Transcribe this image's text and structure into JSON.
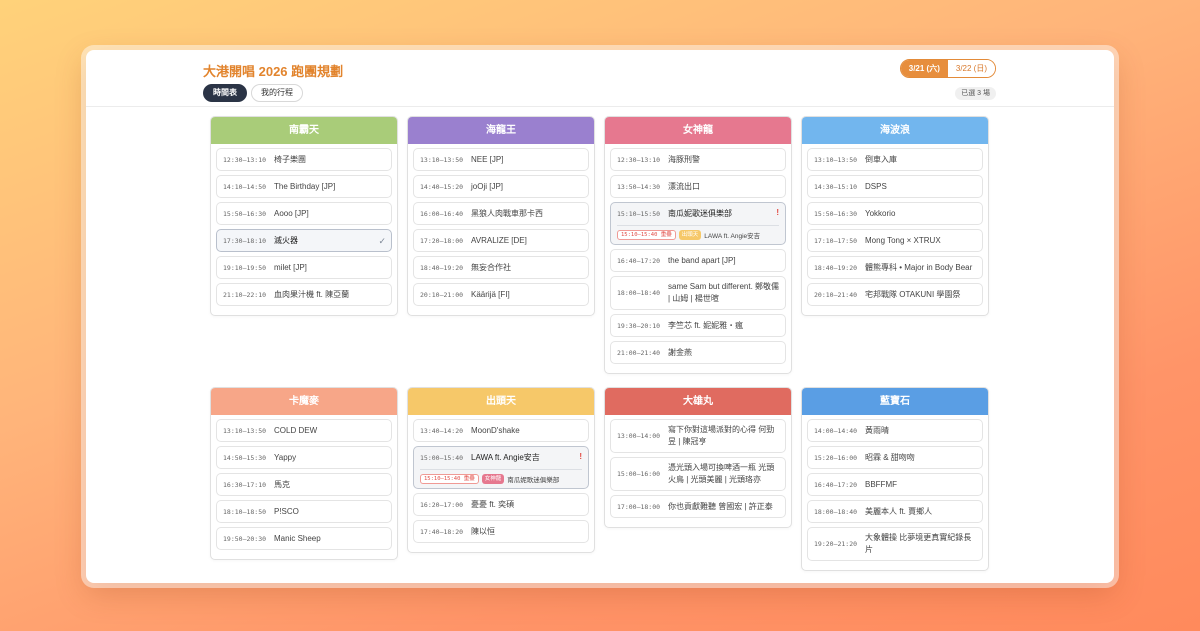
{
  "app": {
    "title": "大港開唱 2026 跑團規劃",
    "view_tabs": [
      "時間表",
      "我的行程"
    ],
    "day_tabs": [
      "3/21 (六)",
      "3/22 (日)"
    ],
    "selected_count": "已選 3 場"
  },
  "colors": {
    "accent": "#e2842d",
    "nav_active": "#2b3446",
    "conflict_red": "#e14b45"
  },
  "stages": [
    {
      "name": "南霸天",
      "color": "#a9cc79",
      "slots": [
        {
          "time": "12:30–13:10",
          "artist": "椅子樂團"
        },
        {
          "time": "14:10–14:50",
          "artist": "The Birthday [JP]"
        },
        {
          "time": "15:50–16:30",
          "artist": "Aooo [JP]"
        },
        {
          "time": "17:30–18:10",
          "artist": "滅火器",
          "selected": true
        },
        {
          "time": "19:10–19:50",
          "artist": "milet [JP]"
        },
        {
          "time": "21:10–22:10",
          "artist": "血肉果汁機 ft. 陳亞蘭"
        }
      ]
    },
    {
      "name": "海龍王",
      "color": "#9a80cf",
      "slots": [
        {
          "time": "13:10–13:50",
          "artist": "NEE [JP]"
        },
        {
          "time": "14:40–15:20",
          "artist": "joOji [JP]"
        },
        {
          "time": "16:00–16:40",
          "artist": "黑狼人肉戰車那卡西"
        },
        {
          "time": "17:20–18:00",
          "artist": "AVRALIZE [DE]"
        },
        {
          "time": "18:40–19:20",
          "artist": "無妄合作社"
        },
        {
          "time": "20:10–21:00",
          "artist": "Käärijä [FI]"
        }
      ]
    },
    {
      "name": "女神龍",
      "color": "#e6788f",
      "slots": [
        {
          "time": "12:30–13:10",
          "artist": "海豚刑警"
        },
        {
          "time": "13:50–14:30",
          "artist": "漂流出口"
        },
        {
          "time": "15:10–15:50",
          "artist": "南瓜妮歌迷俱樂部",
          "conflict": {
            "time": "15:10–15:40 重疊",
            "stage": "出頭天",
            "artist": "LAWA ft. Angie安吉"
          }
        },
        {
          "time": "16:40–17:20",
          "artist": "the band apart [JP]"
        },
        {
          "time": "18:00–18:40",
          "artist": "same Sam but different. 鄭敬儒 | 山姆 | 楊世暄"
        },
        {
          "time": "19:30–20:10",
          "artist": "李竺芯 ft. 妮妮雅・瘋"
        },
        {
          "time": "21:00–21:40",
          "artist": "謝金燕"
        }
      ]
    },
    {
      "name": "海波浪",
      "color": "#72b6ee",
      "slots": [
        {
          "time": "13:10–13:50",
          "artist": "倒車入庫"
        },
        {
          "time": "14:30–15:10",
          "artist": "DSPS"
        },
        {
          "time": "15:50–16:30",
          "artist": "Yokkorio"
        },
        {
          "time": "17:10–17:50",
          "artist": "Mong Tong × XTRUX"
        },
        {
          "time": "18:40–19:20",
          "artist": "體熊專科 • Major in Body Bear"
        },
        {
          "time": "20:10–21:40",
          "artist": "宅邦戰隊 OTAKUNI 學園祭"
        }
      ]
    },
    {
      "name": "卡魔麥",
      "color": "#f7a688",
      "slots": [
        {
          "time": "13:10–13:50",
          "artist": "COLD DEW"
        },
        {
          "time": "14:50–15:30",
          "artist": "Yappy"
        },
        {
          "time": "16:30–17:10",
          "artist": "馬克"
        },
        {
          "time": "18:10–18:50",
          "artist": "P!SCO"
        },
        {
          "time": "19:50–20:30",
          "artist": "Manic Sheep"
        }
      ]
    },
    {
      "name": "出頭天",
      "color": "#f6c869",
      "slots": [
        {
          "time": "13:40–14:20",
          "artist": "MoonD'shake"
        },
        {
          "time": "15:00–15:40",
          "artist": "LAWA ft. Angie安吉",
          "conflict": {
            "time": "15:10–15:40 重疊",
            "stage": "女神龍",
            "artist": "南瓜妮歌迷俱樂部"
          }
        },
        {
          "time": "16:20–17:00",
          "artist": "憂憂 ft. 奕碩"
        },
        {
          "time": "17:40–18:20",
          "artist": "陳以恒"
        }
      ]
    },
    {
      "name": "大雄丸",
      "color": "#e06b60",
      "slots": [
        {
          "time": "13:00–14:00",
          "artist": "寫下你對這場派對的心得 何勁昱 | 陳冠亨"
        },
        {
          "time": "15:00–16:00",
          "artist": "憑光頭入場可換啤酒一瓶 光頭火鳥 | 光頭美麗 | 光頭珞亦"
        },
        {
          "time": "17:00–18:00",
          "artist": "你也貢獻難聽 曾國宏 | 許正泰"
        }
      ]
    },
    {
      "name": "藍寶石",
      "color": "#5a9ee4",
      "slots": [
        {
          "time": "14:00–14:40",
          "artist": "黃雨晴"
        },
        {
          "time": "15:20–16:00",
          "artist": "昭霖 & 甜吻吻"
        },
        {
          "time": "16:40–17:20",
          "artist": "BBFFMF"
        },
        {
          "time": "18:00–18:40",
          "artist": "美麗本人 ft. 賈鄉人"
        },
        {
          "time": "19:20–21:20",
          "artist": "大象體操 比夢境更真實紀錄長片"
        }
      ]
    }
  ]
}
